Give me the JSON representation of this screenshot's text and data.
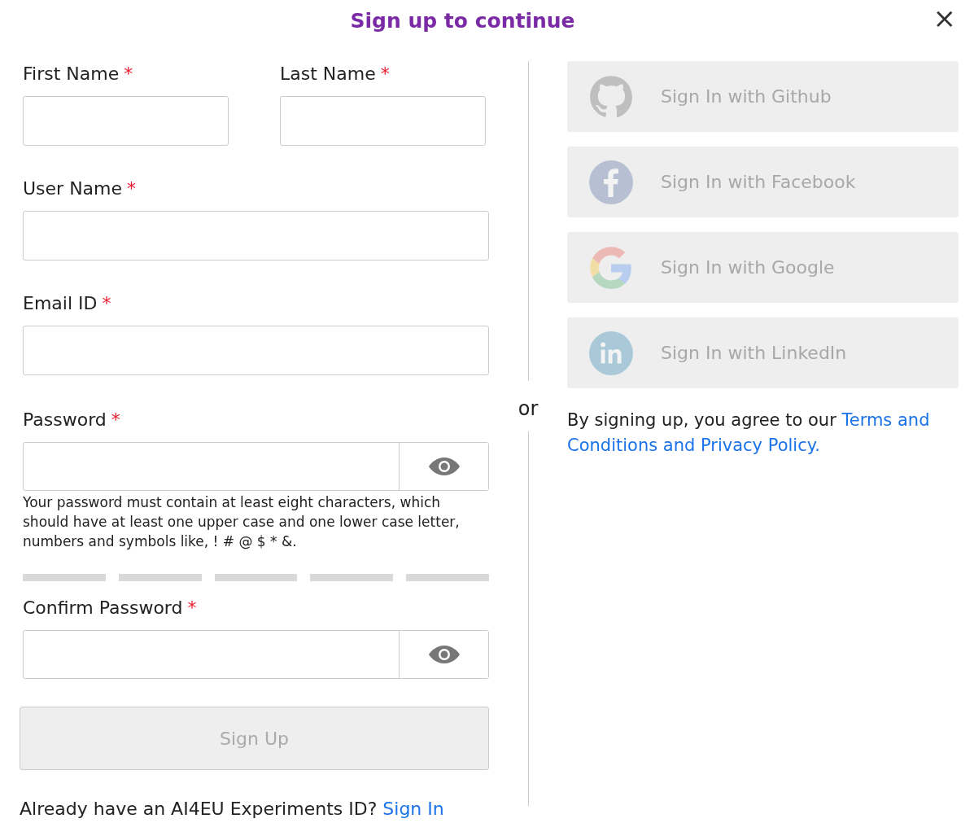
{
  "dialog": {
    "title": "Sign up to continue",
    "close": "×"
  },
  "name_fields": [
    {
      "label": "First Name",
      "required_mark": "*"
    },
    {
      "label": "Last Name",
      "required_mark": "*"
    }
  ],
  "fields": [
    {
      "label": "User Name",
      "required_mark": "*",
      "kind": "text"
    },
    {
      "label": "Email ID",
      "required_mark": "*",
      "kind": "text"
    },
    {
      "label": "Password",
      "required_mark": "*",
      "kind": "password",
      "hint": "Your password must contain at least eight characters, which should have at least one upper case and one lower case letter, numbers and symbols like, ! # @ $ * &."
    },
    {
      "label": "Confirm Password",
      "required_mark": "*",
      "kind": "password"
    }
  ],
  "strength_segments": [
    {
      "filled": false
    },
    {
      "filled": false
    },
    {
      "filled": false
    },
    {
      "filled": false
    },
    {
      "filled": false
    }
  ],
  "sign_up_button": {
    "label": "Sign Up",
    "disabled": true
  },
  "footer": {
    "text": "Already have an AI4EU Experiments ID?",
    "link": "Sign In"
  },
  "separator": "or",
  "social_buttons": [
    {
      "label": "Sign In with Github",
      "kind": "github",
      "disabled": true
    },
    {
      "label": "Sign In with Facebook",
      "kind": "facebook",
      "disabled": true
    },
    {
      "label": "Sign In with Google",
      "kind": "google",
      "disabled": true
    },
    {
      "label": "Sign In with LinkedIn",
      "kind": "linkedin",
      "disabled": true
    }
  ],
  "terms": {
    "text": "By signing up, you agree to our",
    "link_lines": [
      "Terms and",
      "Conditions and Privacy Policy."
    ]
  }
}
